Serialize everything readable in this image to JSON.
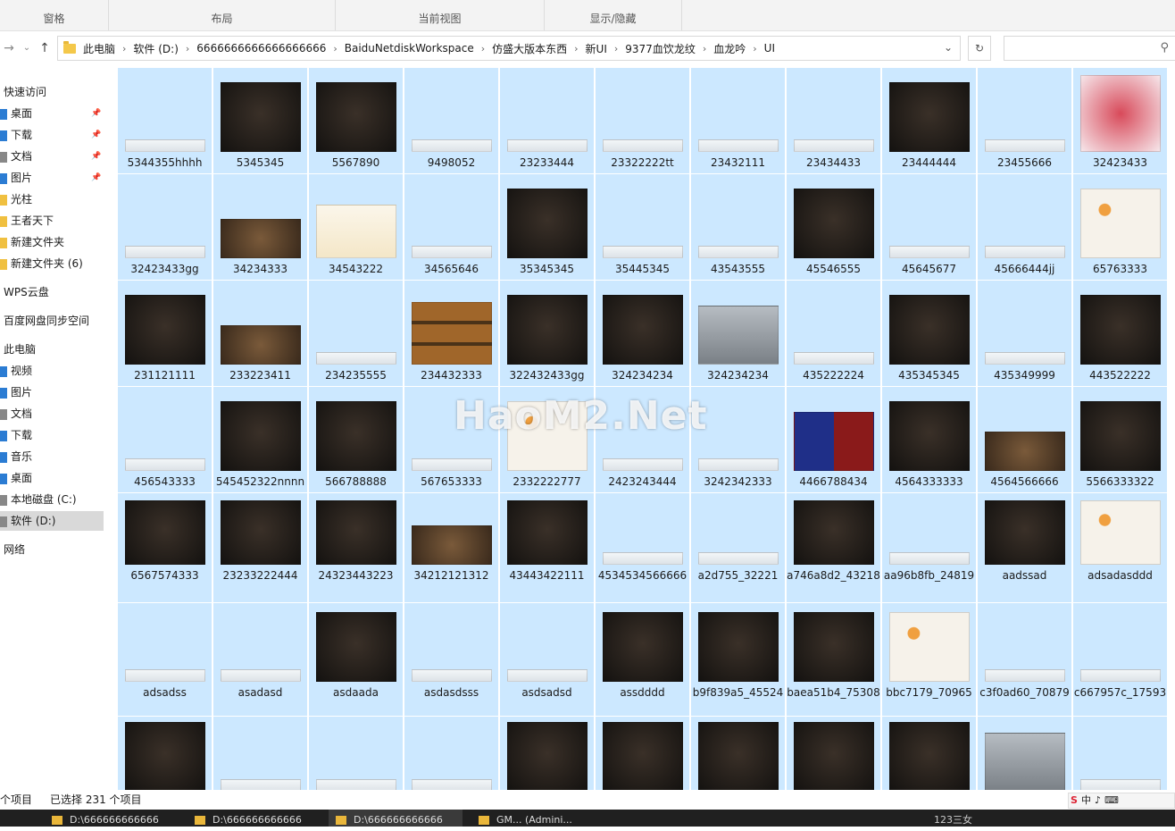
{
  "ribbon": {
    "groups": [
      {
        "label": "窗格"
      },
      {
        "label": "布局"
      },
      {
        "label": "当前视图"
      },
      {
        "label": "显示/隐藏"
      }
    ]
  },
  "address": {
    "crumbs": [
      "此电脑",
      "软件 (D:)",
      "6666666666666666666",
      "BaiduNetdiskWorkspace",
      "仿盛大版本东西",
      "新UI",
      "9377血饮龙纹",
      "血龙吟",
      "UI"
    ],
    "separator": "›",
    "dropdown_icon": "chevron-down-icon",
    "refresh_icon": "refresh-icon",
    "search_icon": "search-icon"
  },
  "nav": {
    "back_icon": "arrow-left-icon",
    "recent_icon": "chevron-down-icon",
    "up_icon": "arrow-up-icon"
  },
  "sidebar": {
    "items": [
      {
        "label": "快速访问",
        "pinned": false,
        "color": ""
      },
      {
        "label": "桌面",
        "pinned": true,
        "color": "#2b7cd3"
      },
      {
        "label": "下载",
        "pinned": true,
        "color": "#2b7cd3"
      },
      {
        "label": "文档",
        "pinned": true,
        "color": "#888888"
      },
      {
        "label": "图片",
        "pinned": true,
        "color": "#2b7cd3"
      },
      {
        "label": "光柱",
        "pinned": false,
        "color": "#f0c040"
      },
      {
        "label": "王者天下",
        "pinned": false,
        "color": "#f0c040"
      },
      {
        "label": "新建文件夹",
        "pinned": false,
        "color": "#f0c040"
      },
      {
        "label": "新建文件夹 (6)",
        "pinned": false,
        "color": "#f0c040"
      },
      {
        "label": "WPS云盘",
        "pinned": false,
        "color": ""
      },
      {
        "label": "百度网盘同步空间",
        "pinned": false,
        "color": ""
      },
      {
        "label": "此电脑",
        "pinned": false,
        "color": ""
      },
      {
        "label": "视频",
        "pinned": false,
        "color": "#2b7cd3"
      },
      {
        "label": "图片",
        "pinned": false,
        "color": "#2b7cd3"
      },
      {
        "label": "文档",
        "pinned": false,
        "color": "#888888"
      },
      {
        "label": "下载",
        "pinned": false,
        "color": "#2b7cd3"
      },
      {
        "label": "音乐",
        "pinned": false,
        "color": "#2b7cd3"
      },
      {
        "label": "桌面",
        "pinned": false,
        "color": "#2b7cd3"
      },
      {
        "label": "本地磁盘 (C:)",
        "pinned": false,
        "color": "#888888"
      },
      {
        "label": "软件 (D:)",
        "pinned": false,
        "color": "#888888",
        "selected": true
      },
      {
        "label": "网络",
        "pinned": false,
        "color": ""
      }
    ],
    "pin_icon": "pin-icon"
  },
  "files": [
    {
      "name": "5344355hhhh",
      "style": "light"
    },
    {
      "name": "5345345",
      "style": "dark"
    },
    {
      "name": "5567890",
      "style": "dark"
    },
    {
      "name": "9498052",
      "style": "light"
    },
    {
      "name": "23233444",
      "style": "light"
    },
    {
      "name": "23322222tt",
      "style": "light"
    },
    {
      "name": "23432111",
      "style": "light"
    },
    {
      "name": "23434433",
      "style": "light"
    },
    {
      "name": "23444444",
      "style": "dark"
    },
    {
      "name": "23455666",
      "style": "light"
    },
    {
      "name": "32423433",
      "style": "red"
    },
    {
      "name": "32423433gg",
      "style": "light"
    },
    {
      "name": "34234333",
      "style": "brown"
    },
    {
      "name": "34543222",
      "style": "gold-text"
    },
    {
      "name": "34565646",
      "style": "light"
    },
    {
      "name": "35345345",
      "style": "dark"
    },
    {
      "name": "35445345",
      "style": "light"
    },
    {
      "name": "43543555",
      "style": "light"
    },
    {
      "name": "45546555",
      "style": "dark"
    },
    {
      "name": "45645677",
      "style": "light"
    },
    {
      "name": "45666444jj",
      "style": "light"
    },
    {
      "name": "65763333",
      "style": "orange"
    },
    {
      "name": "231121111",
      "style": "dark"
    },
    {
      "name": "233223411",
      "style": "brown"
    },
    {
      "name": "234235555",
      "style": "light"
    },
    {
      "name": "234432333",
      "style": "buttons"
    },
    {
      "name": "322432433gg",
      "style": "dark"
    },
    {
      "name": "324234234",
      "style": "dark"
    },
    {
      "name": "324234234",
      "style": "grey"
    },
    {
      "name": "435222224",
      "style": "light"
    },
    {
      "name": "435345345",
      "style": "dark"
    },
    {
      "name": "435349999",
      "style": "light"
    },
    {
      "name": "443522222",
      "style": "dark"
    },
    {
      "name": "456543333",
      "style": "light"
    },
    {
      "name": "545452322nnnn",
      "style": "dark"
    },
    {
      "name": "566788888",
      "style": "dark"
    },
    {
      "name": "567653333",
      "style": "light"
    },
    {
      "name": "2332222777",
      "style": "orange"
    },
    {
      "name": "2423243444",
      "style": "light"
    },
    {
      "name": "3242342333",
      "style": "light"
    },
    {
      "name": "4466788434",
      "style": "blue-red"
    },
    {
      "name": "4564333333",
      "style": "dark"
    },
    {
      "name": "4564566666",
      "style": "brown"
    },
    {
      "name": "5566333322",
      "style": "dark"
    },
    {
      "name": "6567574333",
      "style": "dark"
    },
    {
      "name": "23233222444",
      "style": "dark"
    },
    {
      "name": "24323443223",
      "style": "dark"
    },
    {
      "name": "34212121312",
      "style": "brown"
    },
    {
      "name": "43443422111",
      "style": "dark"
    },
    {
      "name": "4534534566666",
      "style": "light"
    },
    {
      "name": "a2d755_32221",
      "style": "light"
    },
    {
      "name": "a746a8d2_43218",
      "style": "dark"
    },
    {
      "name": "aa96b8fb_24819",
      "style": "light"
    },
    {
      "name": "aadssad",
      "style": "dark"
    },
    {
      "name": "adsadasddd",
      "style": "orange"
    },
    {
      "name": "adsadss",
      "style": "light"
    },
    {
      "name": "asadasd",
      "style": "light"
    },
    {
      "name": "asdaada",
      "style": "dark"
    },
    {
      "name": "asdasdsss",
      "style": "light"
    },
    {
      "name": "asdsadsd",
      "style": "light"
    },
    {
      "name": "assdddd",
      "style": "dark"
    },
    {
      "name": "b9f839a5_45524",
      "style": "dark"
    },
    {
      "name": "baea51b4_75308",
      "style": "dark"
    },
    {
      "name": "bbc7179_70965",
      "style": "orange"
    },
    {
      "name": "c3f0ad60_70879",
      "style": "light"
    },
    {
      "name": "c667957c_17593",
      "style": "light"
    },
    {
      "name": "",
      "style": "dark"
    },
    {
      "name": "",
      "style": "light"
    },
    {
      "name": "",
      "style": "light"
    },
    {
      "name": "",
      "style": "light"
    },
    {
      "name": "",
      "style": "dark"
    },
    {
      "name": "",
      "style": "dark"
    },
    {
      "name": "",
      "style": "dark"
    },
    {
      "name": "",
      "style": "dark"
    },
    {
      "name": "",
      "style": "dark"
    },
    {
      "name": "",
      "style": "grey"
    },
    {
      "name": "",
      "style": "light"
    }
  ],
  "watermark": "HaoM2.Net",
  "status": {
    "count": "个项目",
    "selected": "已选择 231 个项目"
  },
  "ime": {
    "labels": [
      "S",
      "中",
      "♪",
      "⌨"
    ]
  },
  "taskbar": {
    "tasks": [
      {
        "label": "D:\\666666666666"
      },
      {
        "label": "D:\\666666666666"
      },
      {
        "label": "D:\\666666666666"
      },
      {
        "label": "GM... (Admini..."
      }
    ],
    "tray_text": "123三女"
  },
  "colors": {
    "selection": "#cce8ff",
    "ribbon_bg": "#f3f3f3",
    "taskbar_bg": "#202020"
  }
}
